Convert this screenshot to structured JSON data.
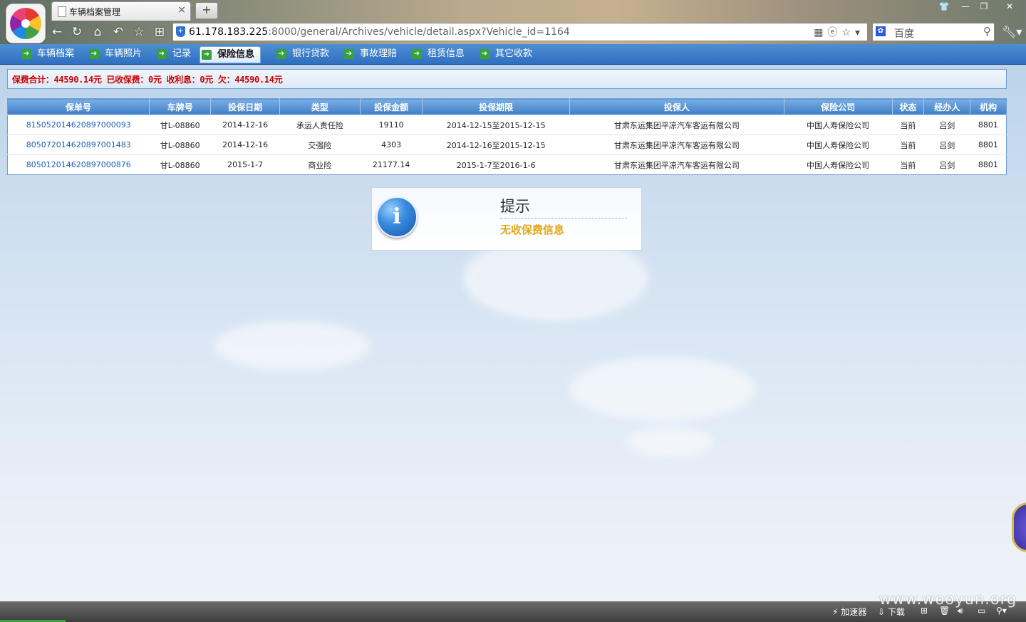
{
  "browser": {
    "tab_title": "车辆档案管理",
    "tab_close": "×",
    "new_tab": "+",
    "url_host": "61.178.183.225",
    "url_rest": ":8000/general/Archives/vehicle/detail.aspx?Vehicle_id=1164",
    "search_placeholder": "百度",
    "window_buttons": [
      "👕",
      "—",
      "❐",
      "✕"
    ]
  },
  "nav": {
    "items": [
      {
        "label": "车辆档案"
      },
      {
        "label": "车辆照片"
      },
      {
        "label": "记录"
      },
      {
        "label": "保险信息"
      },
      {
        "label": "银行贷款"
      },
      {
        "label": "事故理赔"
      },
      {
        "label": "租赁信息"
      },
      {
        "label": "其它收款"
      }
    ],
    "active_index": 3
  },
  "summary": "保费合计：44590.14元 已收保费：0元 收利息：0元 欠：44590.14元",
  "table": {
    "headers": [
      "保单号",
      "车牌号",
      "投保日期",
      "类型",
      "投保金额",
      "投保期限",
      "投保人",
      "保险公司",
      "状态",
      "经办人",
      "机构"
    ],
    "rows": [
      [
        "815052014620897000093",
        "甘L-08860",
        "2014-12-16",
        "承运人责任险",
        "19110",
        "2014-12-15至2015-12-15",
        "甘肃东运集团平凉汽车客运有限公司",
        "中国人寿保险公司",
        "当前",
        "吕剑",
        "8801"
      ],
      [
        "805072014620897001483",
        "甘L-08860",
        "2014-12-16",
        "交强险",
        "4303",
        "2014-12-16至2015-12-15",
        "甘肃东运集团平凉汽车客运有限公司",
        "中国人寿保险公司",
        "当前",
        "吕剑",
        "8801"
      ],
      [
        "805012014620897000876",
        "甘L-08860",
        "2015-1-7",
        "商业险",
        "21177.14",
        "2015-1-7至2016-1-6",
        "甘肃东运集团平凉汽车客运有限公司",
        "中国人寿保险公司",
        "当前",
        "吕剑",
        "8801"
      ]
    ]
  },
  "notice": {
    "title": "提示",
    "message": "无收保费信息",
    "icon": "i"
  },
  "statusbar": {
    "accelerator": "加速器",
    "download": "下载"
  },
  "watermark": "www.wooyun.org"
}
